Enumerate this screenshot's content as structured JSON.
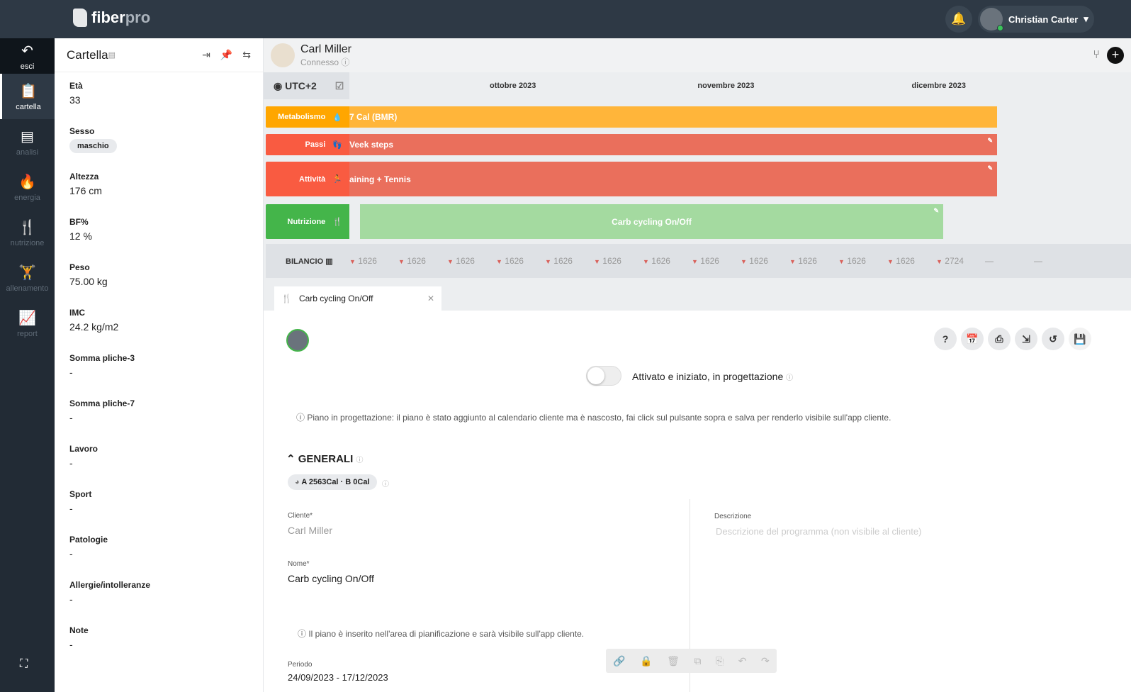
{
  "brand": {
    "name_a": "fiber",
    "name_b": "pro"
  },
  "header": {
    "user_name": "Christian Carter",
    "icons": [
      "bell-icon",
      "caret-down-icon"
    ]
  },
  "nav": [
    {
      "label": "esci",
      "icon": "↶"
    },
    {
      "label": "cartella",
      "icon": "📋"
    },
    {
      "label": "analisi",
      "icon": "▤"
    },
    {
      "label": "energia",
      "icon": "🔥"
    },
    {
      "label": "nutrizione",
      "icon": "🍴"
    },
    {
      "label": "allenamento",
      "icon": "🏋"
    },
    {
      "label": "report",
      "icon": "📈"
    }
  ],
  "left": {
    "title": "Cartella",
    "fields": [
      {
        "k": "Età",
        "v": "33"
      },
      {
        "k": "Sesso",
        "chip": "maschio"
      },
      {
        "k": "Altezza",
        "v": "176 cm"
      },
      {
        "k": "BF%",
        "v": "12 %"
      },
      {
        "k": "Peso",
        "v": "75.00 kg"
      },
      {
        "k": "IMC",
        "v": "24.2 kg/m2"
      },
      {
        "k": "Somma pliche-3",
        "v": "-"
      },
      {
        "k": "Somma pliche-7",
        "v": "-"
      },
      {
        "k": "Lavoro",
        "v": "-"
      },
      {
        "k": "Sport",
        "v": "-"
      },
      {
        "k": "Patologie",
        "v": "-"
      },
      {
        "k": "Allergie/intolleranze",
        "v": "-"
      },
      {
        "k": "Note",
        "v": "-"
      }
    ]
  },
  "patient": {
    "name": "Carl Miller",
    "status": "Connesso"
  },
  "timeline": {
    "tz": "UTC+2",
    "months": [
      "ottobre 2023",
      "novembre 2023",
      "dicembre 2023"
    ],
    "rows": [
      {
        "label": "Metabolismo",
        "text": "7 Cal (BMR)",
        "color": "#ffb53a",
        "label_color": "#ffa600"
      },
      {
        "label": "Passi",
        "text": "Veek steps",
        "color": "#ea6f5c",
        "label_color": "#f95b41"
      },
      {
        "label": "Attività",
        "text": "aining + Tennis",
        "color": "#ea6f5c",
        "label_color": "#f95b41"
      },
      {
        "label": "Nutrizione",
        "text": "Carb cycling On/Off",
        "color": "#a4daa0",
        "label_color": "#44b54a"
      }
    ],
    "bilancio_label": "BILANCIO",
    "bilancio": [
      "1626",
      "1626",
      "1626",
      "1626",
      "1626",
      "1626",
      "1626",
      "1626",
      "1626",
      "1626",
      "1626",
      "1626",
      "2724",
      "—",
      "—"
    ]
  },
  "tab": {
    "label": "Carb cycling On/Off"
  },
  "plan": {
    "toggle_label": "Attivato e iniziato, in progettazione",
    "toggle_on": false,
    "note1": "ⓘ Piano in progettazione: il piano è stato aggiunto al calendario cliente ma è nascosto, fai click sul pulsante sopra e salva per renderlo visibile sull'app cliente.",
    "section": "GENERALI",
    "kcal": "A 2563Cal · B 0Cal",
    "cliente_label": "Cliente*",
    "cliente": "Carl Miller",
    "nome_label": "Nome*",
    "nome": "Carb cycling On/Off",
    "desc_label": "Descrizione",
    "desc_placeholder": "Descrizione del programma (non visibile al cliente)",
    "note2": "ⓘ Il piano è inserito nell'area di pianificazione e sarà visibile sull'app cliente.",
    "periodo_label": "Periodo",
    "periodo": "24/09/2023 - 17/12/2023"
  }
}
